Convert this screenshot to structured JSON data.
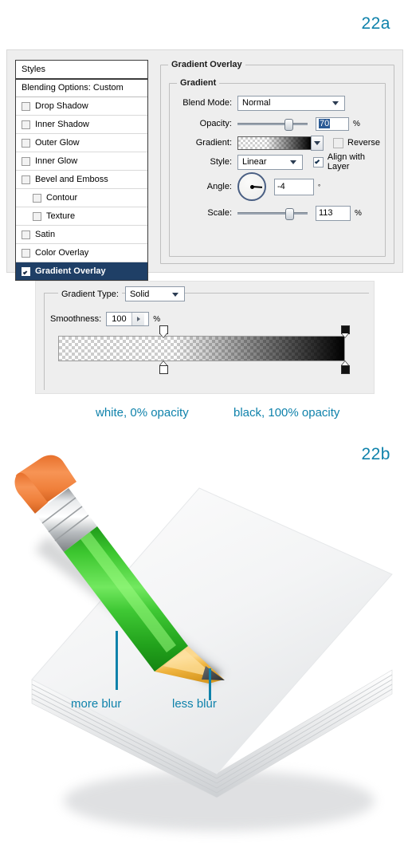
{
  "figures": {
    "top_label": "22a",
    "bottom_label": "22b"
  },
  "layer_style_dialog": {
    "styles_panel": {
      "header": "Styles",
      "blending_options": "Blending Options: Custom",
      "effects": [
        {
          "label": "Drop Shadow",
          "checked": false,
          "indent": false,
          "selected": false
        },
        {
          "label": "Inner Shadow",
          "checked": false,
          "indent": false,
          "selected": false
        },
        {
          "label": "Outer Glow",
          "checked": false,
          "indent": false,
          "selected": false
        },
        {
          "label": "Inner Glow",
          "checked": false,
          "indent": false,
          "selected": false
        },
        {
          "label": "Bevel and Emboss",
          "checked": false,
          "indent": false,
          "selected": false
        },
        {
          "label": "Contour",
          "checked": false,
          "indent": true,
          "selected": false
        },
        {
          "label": "Texture",
          "checked": false,
          "indent": true,
          "selected": false
        },
        {
          "label": "Satin",
          "checked": false,
          "indent": false,
          "selected": false
        },
        {
          "label": "Color Overlay",
          "checked": false,
          "indent": false,
          "selected": false
        },
        {
          "label": "Gradient Overlay",
          "checked": true,
          "indent": false,
          "selected": true
        }
      ]
    },
    "panel": {
      "outer_group_title": "Gradient Overlay",
      "inner_group_title": "Gradient",
      "blend_mode": {
        "label": "Blend Mode:",
        "value": "Normal"
      },
      "opacity": {
        "label": "Opacity:",
        "value": "70",
        "unit": "%"
      },
      "gradient": {
        "label": "Gradient:"
      },
      "reverse": {
        "label": "Reverse",
        "checked": false
      },
      "style": {
        "label": "Style:",
        "value": "Linear"
      },
      "align_with_layer": {
        "label": "Align with Layer",
        "checked": true
      },
      "angle": {
        "label": "Angle:",
        "value": "-4",
        "unit": "°"
      },
      "scale": {
        "label": "Scale:",
        "value": "113",
        "unit": "%"
      }
    }
  },
  "gradient_editor": {
    "gradient_type": {
      "label": "Gradient Type:",
      "value": "Solid"
    },
    "smoothness": {
      "label": "Smoothness:",
      "value": "100",
      "unit": "%"
    },
    "stops": {
      "opacity_left": "0%",
      "opacity_right": "100%",
      "color_left": "white",
      "color_right": "black"
    }
  },
  "captions": {
    "white_stop": "white, 0% opacity",
    "black_stop": "black, 100% opacity",
    "more_blur": "more blur",
    "less_blur": "less blur"
  },
  "colors": {
    "accent_teal": "#0f82ab",
    "selection_navy": "#1f3f66",
    "dialog_bg": "#eeeeee",
    "pencil_body": "#35c92b",
    "pencil_eraser": "#ef7f3a",
    "pencil_ferrule": "#c9ccce",
    "pencil_wood": "#f5c35a",
    "pencil_graphite": "#4a4a4a"
  }
}
